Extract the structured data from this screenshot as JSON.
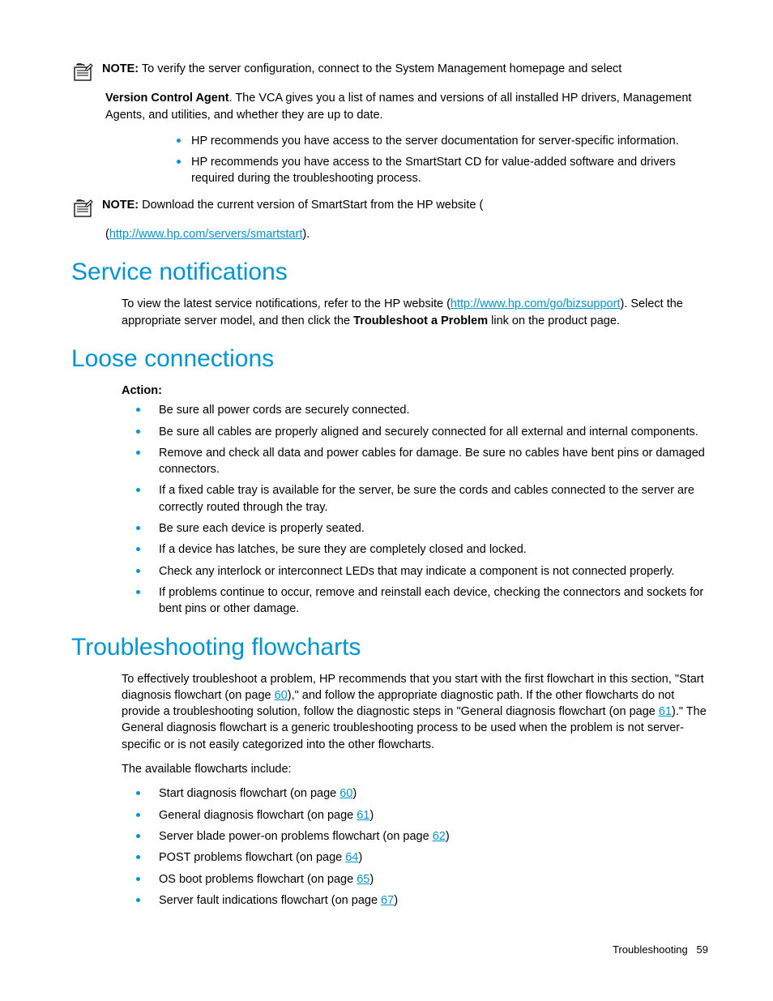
{
  "note1": {
    "label": "NOTE:",
    "line1": "To verify the server configuration, connect to the System Management homepage and select ",
    "bold": "Version Control Agent",
    "line2": ". The VCA gives you a list of names and versions of all installed HP drivers, Management Agents, and utilities, and whether they are up to date."
  },
  "bullets1": [
    "HP recommends you have access to the server documentation for server-specific information.",
    "HP recommends you have access to the SmartStart CD for value-added software and drivers required during the troubleshooting process."
  ],
  "note2": {
    "label": "NOTE:",
    "text": "Download the current version of SmartStart from the HP website (",
    "link": "http://www.hp.com/servers/smartstart",
    "close": ")."
  },
  "section1": {
    "title": "Service notifications",
    "p1a": "To view the latest service notifications, refer to the HP website (",
    "link": "http://www.hp.com/go/bizsupport",
    "p1b": "). Select the appropriate server model, and then click the ",
    "bold": "Troubleshoot a Problem",
    "p1c": " link on the product page."
  },
  "section2": {
    "title": "Loose connections",
    "action_label": "Action",
    "action_colon": ":",
    "items": [
      "Be sure all power cords are securely connected.",
      "Be sure all cables are properly aligned and securely connected for all external and internal components.",
      "Remove and check all data and power cables for damage. Be sure no cables have bent pins or damaged connectors.",
      "If a fixed cable tray is available for the server, be sure the cords and cables connected to the server are correctly routed through the tray.",
      "Be sure each device is properly seated.",
      "If a device has latches, be sure they are completely closed and locked.",
      "Check any interlock or interconnect LEDs that may indicate a component is not connected properly.",
      "If problems continue to occur, remove and reinstall each device, checking the connectors and sockets for bent pins or other damage."
    ]
  },
  "section3": {
    "title": "Troubleshooting flowcharts",
    "p1a": "To effectively troubleshoot a problem, HP recommends that you start with the first flowchart in this section, \"Start diagnosis flowchart (on page ",
    "link1": "60",
    "p1b": "),\" and follow the appropriate diagnostic path. If the other flowcharts do not provide a troubleshooting solution, follow the diagnostic steps in \"General diagnosis flowchart (on page ",
    "link2": "61",
    "p1c": ").\" The General diagnosis flowchart is a generic troubleshooting process to be used when the problem is not server-specific or is not easily categorized into the other flowcharts.",
    "p2": "The available flowcharts include:",
    "items": [
      {
        "pre": "Start diagnosis flowchart (on page ",
        "page": "60",
        "post": ")"
      },
      {
        "pre": "General diagnosis flowchart (on page ",
        "page": "61",
        "post": ")"
      },
      {
        "pre": "Server blade power-on problems flowchart (on page ",
        "page": "62",
        "post": ")"
      },
      {
        "pre": "POST problems flowchart (on page ",
        "page": "64",
        "post": ")"
      },
      {
        "pre": "OS boot problems flowchart (on page ",
        "page": "65",
        "post": ")"
      },
      {
        "pre": "Server fault indications flowchart (on page ",
        "page": "67",
        "post": ")"
      }
    ]
  },
  "footer": {
    "section": "Troubleshooting",
    "page": "59"
  }
}
